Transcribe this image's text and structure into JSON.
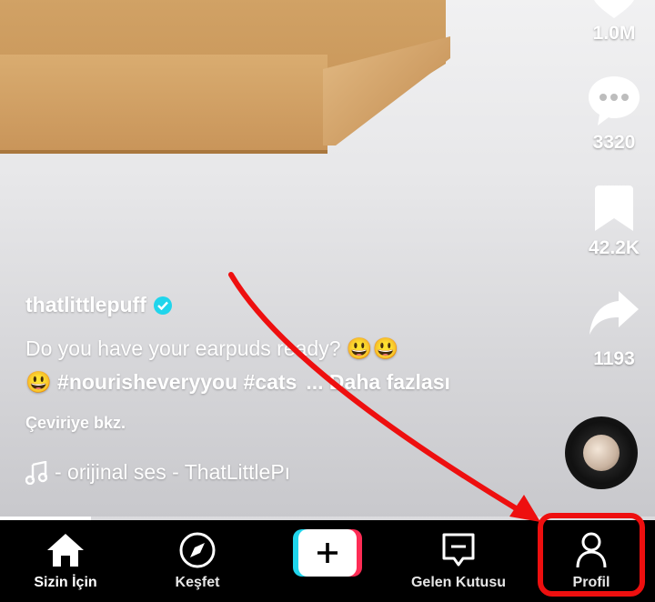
{
  "side": {
    "likes": "1.0M",
    "comments": "3320",
    "bookmarks": "42.2K",
    "shares": "1193"
  },
  "post": {
    "username": "thatlittlepuff",
    "description_line1": "Do you have your earpuds ready? 😃😃",
    "description_emoji": "😃",
    "hashtags": "#nourisheveryyou #cats",
    "more": "... Daha fazlası",
    "translate": "Çeviriye bkz.",
    "music": "- orijinal ses - ThatLittlePı"
  },
  "nav": {
    "home": "Sizin İçin",
    "discover": "Keşfet",
    "inbox": "Gelen Kutusu",
    "profile": "Profil"
  },
  "colors": {
    "highlight": "#ee0f0f",
    "accent_cyan": "#20d5ec",
    "accent_red": "#fe2c55"
  }
}
